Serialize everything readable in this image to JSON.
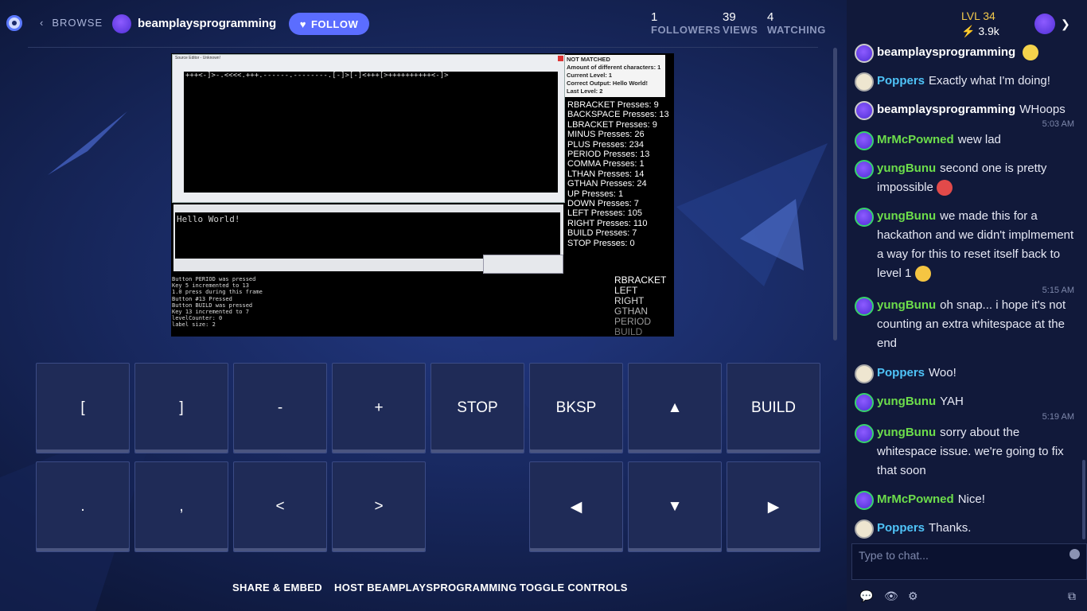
{
  "header": {
    "browse": "BROWSE",
    "channel": "beamplaysprogramming",
    "follow": "FOLLOW",
    "stats": [
      {
        "value": "1",
        "label": "FOLLOWERS"
      },
      {
        "value": "39",
        "label": "VIEWS"
      },
      {
        "value": "4",
        "label": "WATCHING"
      }
    ]
  },
  "user": {
    "level": "LVL 34",
    "points": "3.9k"
  },
  "stream": {
    "editor_title": "Source Editor - Unknown!",
    "code": "+++<-]>-.<<<<.+++.------.--------.[-]>[-]<+++[>++++++++++<-]>",
    "output": "Hello World!",
    "info": [
      "NOT MATCHED",
      "Amount of different characters: 1",
      "Current Level: 1",
      "Correct Output: Hello World!",
      "Last Level: 2"
    ],
    "presses": [
      "RBRACKET Presses: 9",
      "BACKSPACE Presses: 13",
      "LBRACKET Presses: 9",
      "MINUS Presses: 26",
      "PLUS Presses: 234",
      "PERIOD Presses: 13",
      "COMMA Presses: 1",
      "LTHAN Presses: 14",
      "GTHAN Presses: 24",
      "UP Presses: 1",
      "DOWN Presses: 7",
      "LEFT Presses: 105",
      "RIGHT Presses: 110",
      "BUILD Presses: 7",
      "STOP Presses: 0"
    ],
    "log": [
      "Button PERIOD was pressed",
      "Key 5 incremented to 13",
      "1.0 press during this frame",
      "Button #13 Pressed",
      "Button BUILD was pressed",
      "Key 13 incremented to 7",
      "levelCounter: 0",
      "label size: 2"
    ],
    "key_queue": [
      "RBRACKET",
      "LEFT",
      "RIGHT",
      "GTHAN",
      "PERIOD",
      "BUILD"
    ]
  },
  "controls": {
    "row1": [
      "[",
      "]",
      "-",
      "+",
      "STOP",
      "BKSP",
      "▲",
      "BUILD"
    ],
    "row2": [
      ".",
      ",",
      "<",
      ">",
      "◀",
      "▼",
      "▶"
    ]
  },
  "actions": {
    "share": "SHARE & EMBED",
    "host": "HOST BEAMPLAYSPROGRAMMING",
    "toggle": "TOGGLE CONTROLS"
  },
  "chat": {
    "messages": [
      {
        "user": "beamplaysprogramming",
        "text": ""
      },
      {
        "user": "Poppers",
        "text": "Exactly what I'm doing!"
      },
      {
        "user": "beamplaysprogramming",
        "text": "WHoops"
      },
      {
        "user": "MrMcPowned",
        "text": "wew lad"
      },
      {
        "user": "yungBunu",
        "text": "second one is pretty impossible"
      },
      {
        "user": "yungBunu",
        "text": "we made this for a hackathon and we didn't implmement a way for this to reset itself back to level 1"
      },
      {
        "user": "yungBunu",
        "text": "oh snap... i hope it's not counting an extra whitespace at the end"
      },
      {
        "user": "Poppers",
        "text": "Woo!"
      },
      {
        "user": "yungBunu",
        "text": "YAH"
      },
      {
        "user": "yungBunu",
        "text": "sorry about the whitespace issue. we're going to fix that soon"
      },
      {
        "user": "MrMcPowned",
        "text": "Nice!"
      },
      {
        "user": "Poppers",
        "text": "Thanks."
      }
    ],
    "timestamps": [
      "5:03 AM",
      "5:15 AM",
      "5:19 AM"
    ],
    "placeholder": "Type to chat...",
    "colors": {
      "streamer": "#ffffff",
      "mod": "#4fc3f7",
      "viewer": "#6dde4b"
    }
  }
}
